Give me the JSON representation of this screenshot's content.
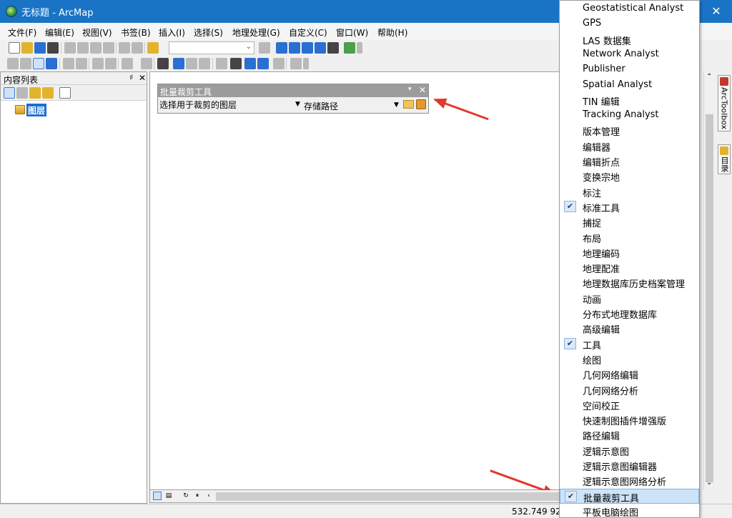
{
  "window": {
    "title": "无标题 - ArcMap",
    "close_glyph": "✕"
  },
  "menubar": [
    "文件(F)",
    "编辑(E)",
    "视图(V)",
    "书签(B)",
    "插入(I)",
    "选择(S)",
    "地理处理(G)",
    "自定义(C)",
    "窗口(W)",
    "帮助(H)"
  ],
  "toc": {
    "title": "内容列表",
    "pin_glyph": "♯",
    "close_glyph": "✕",
    "root_layer": "图层"
  },
  "float_toolbar": {
    "title": "批量裁剪工具",
    "menu_glyph": "▾",
    "close_glyph": "✕",
    "layer_combo": "选择用于裁剪的图层",
    "path_label": "存储路径",
    "arrow_glyph": "▼"
  },
  "statusbar": {
    "coords": "532.749  92"
  },
  "side_tabs": [
    "ArcToolbox",
    "目录"
  ],
  "context_menu": {
    "items": [
      {
        "label": "Geostatistical Analyst",
        "checked": false
      },
      {
        "label": "GPS",
        "checked": false
      },
      {
        "label": "LAS 数据集",
        "checked": false
      },
      {
        "label": "Network Analyst",
        "checked": false
      },
      {
        "label": "Publisher",
        "checked": false
      },
      {
        "label": "Spatial Analyst",
        "checked": false
      },
      {
        "label": "TIN 编辑",
        "checked": false
      },
      {
        "label": "Tracking Analyst",
        "checked": false
      },
      {
        "label": "版本管理",
        "checked": false
      },
      {
        "label": "编辑器",
        "checked": false
      },
      {
        "label": "编辑折点",
        "checked": false
      },
      {
        "label": "变换宗地",
        "checked": false
      },
      {
        "label": "标注",
        "checked": false
      },
      {
        "label": "标准工具",
        "checked": true
      },
      {
        "label": "捕捉",
        "checked": false
      },
      {
        "label": "布局",
        "checked": false
      },
      {
        "label": "地理编码",
        "checked": false
      },
      {
        "label": "地理配准",
        "checked": false
      },
      {
        "label": "地理数据库历史档案管理",
        "checked": false
      },
      {
        "label": "动画",
        "checked": false
      },
      {
        "label": "分布式地理数据库",
        "checked": false
      },
      {
        "label": "高级编辑",
        "checked": false
      },
      {
        "label": "工具",
        "checked": true
      },
      {
        "label": "绘图",
        "checked": false
      },
      {
        "label": "几何网络编辑",
        "checked": false
      },
      {
        "label": "几何网络分析",
        "checked": false
      },
      {
        "label": "空间校正",
        "checked": false
      },
      {
        "label": "快速制图插件增强版",
        "checked": false
      },
      {
        "label": "路径编辑",
        "checked": false
      },
      {
        "label": "逻辑示意图",
        "checked": false
      },
      {
        "label": "逻辑示意图编辑器",
        "checked": false
      },
      {
        "label": "逻辑示意图网络分析",
        "checked": false
      },
      {
        "label": "批量裁剪工具",
        "checked": true,
        "highlighted": true
      },
      {
        "label": "平板电脑绘图",
        "checked": false
      }
    ],
    "check_glyph": "✔"
  },
  "colors": {
    "titlebar": "#1a74c6",
    "highlight": "#cde3f7",
    "annotation_arrow": "#e03a2c"
  }
}
